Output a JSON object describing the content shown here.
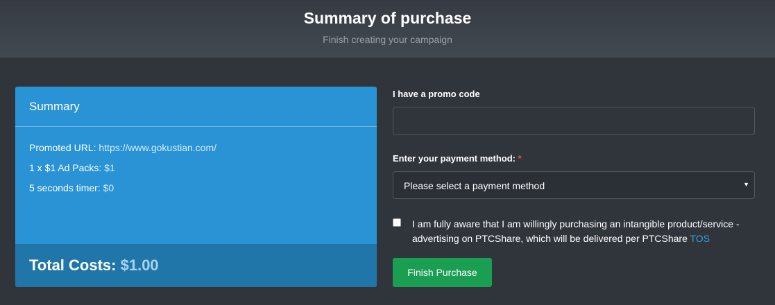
{
  "header": {
    "title": "Summary of purchase",
    "subtitle": "Finish creating your campaign"
  },
  "summary": {
    "title": "Summary",
    "promoted_url_label": "Promoted URL:",
    "promoted_url_value": "https://www.gokustian.com/",
    "ad_packs_label": "1 x $1 Ad Packs:",
    "ad_packs_value": "$1",
    "timer_label": "5 seconds timer:",
    "timer_value": "$0",
    "total_label": "Total Costs:",
    "total_value": "$1.00"
  },
  "form": {
    "promo_label": "I have a promo code",
    "promo_value": "",
    "payment_label": "Enter your payment method:",
    "required_mark": "*",
    "payment_selected": "Please select a payment method",
    "caret": "▼",
    "agree_line1": "I am fully aware that I am willingly purchasing an intangible product/service -",
    "agree_line2": "advertising on PTCShare, which will be delivered per PTCShare ",
    "tos_link": "TOS",
    "finish_label": "Finish Purchase"
  }
}
